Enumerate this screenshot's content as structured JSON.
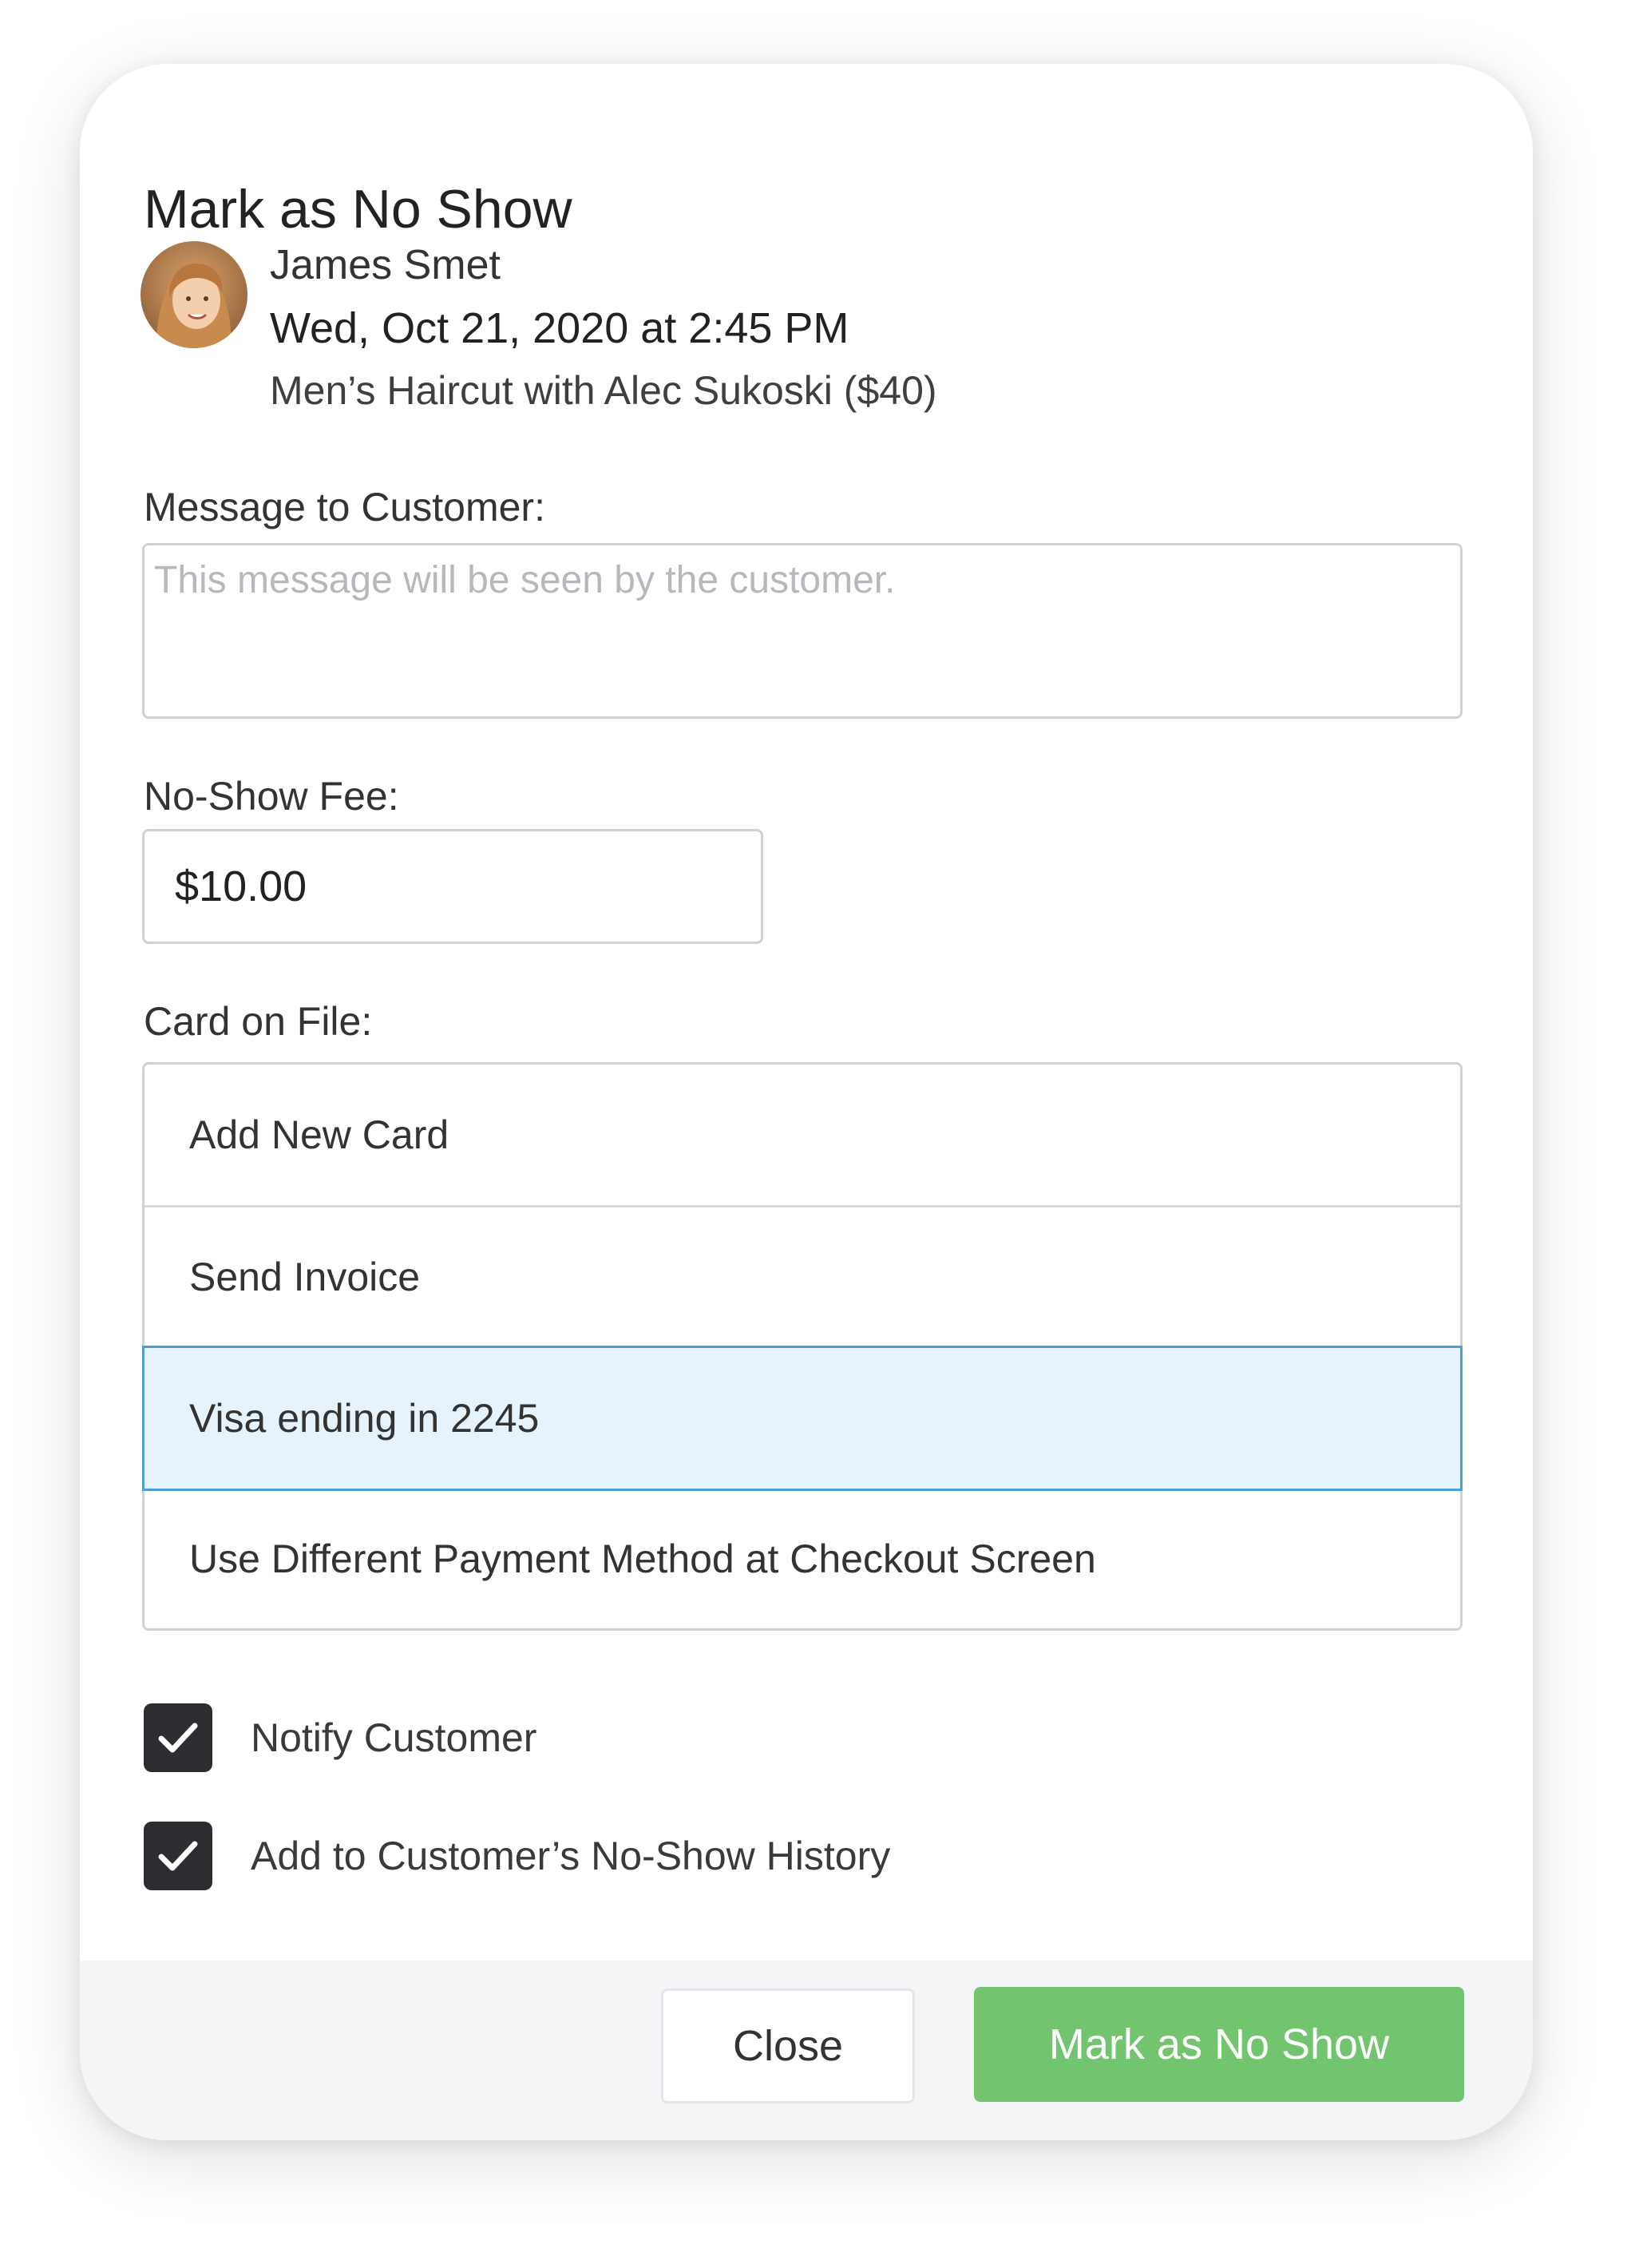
{
  "dialog": {
    "title": "Mark as No Show"
  },
  "appointment": {
    "customer_name": "James Smet",
    "datetime": "Wed, Oct 21, 2020 at 2:45 PM",
    "service": "Men’s Haircut with Alec Sukoski ($40)"
  },
  "message": {
    "label": "Message to Customer:",
    "value": "",
    "placeholder": "This message will be seen by the customer."
  },
  "fee": {
    "label": "No-Show Fee:",
    "value": "$10.00"
  },
  "card_on_file": {
    "label": "Card on File:",
    "options": [
      "Add New Card",
      "Send Invoice",
      "Visa ending in 2245",
      "Use Different Payment Method at Checkout Screen"
    ],
    "selected": "Visa ending in 2245"
  },
  "checkboxes": [
    {
      "label": "Notify Customer",
      "checked": true
    },
    {
      "label": "Add to Customer’s No-Show History",
      "checked": true
    }
  ],
  "footer": {
    "close_label": "Close",
    "confirm_label": "Mark as No Show"
  },
  "colors": {
    "primary_button": "#72c46e",
    "selected_option_bg": "#e6f3fc",
    "selected_option_border": "#4a9fd8",
    "checkbox_fill": "#2b2d30"
  },
  "icons": [
    "avatar-photo",
    "checkmark-icon"
  ]
}
